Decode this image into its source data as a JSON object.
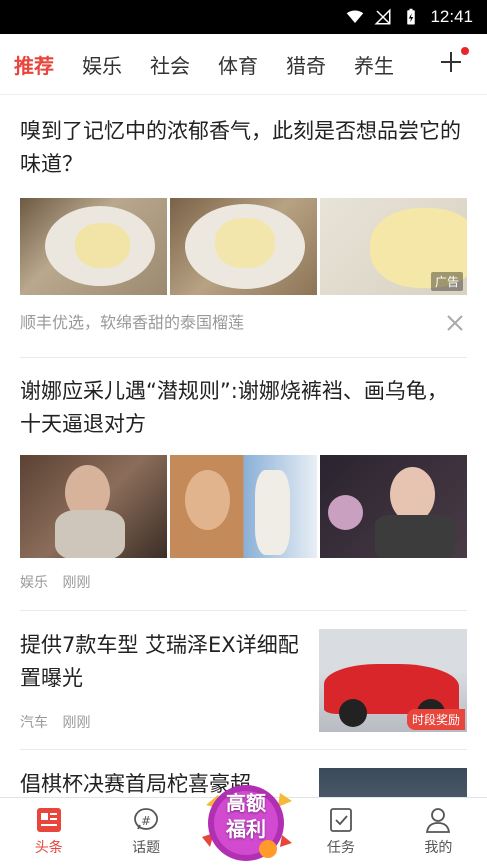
{
  "status": {
    "time": "12:41"
  },
  "tabs": [
    "推荐",
    "娱乐",
    "社会",
    "体育",
    "猎奇",
    "养生"
  ],
  "feed": {
    "ad": {
      "title": "嗅到了记忆中的浓郁香气，此刻是否想品尝它的味道？",
      "tag": "广告",
      "desc": "顺丰优选，软绵香甜的泰国榴莲"
    },
    "article1": {
      "title": "谢娜应采儿遇“潜规则”:谢娜烧裤裆、画乌龟，十天逼退对方",
      "category": "娱乐",
      "time": "刚刚"
    },
    "article2": {
      "title": "提供7款车型 艾瑞泽EX详细配置曝光",
      "category": "汽车",
      "time": "刚刚",
      "badge": "时段奖励"
    },
    "article3": {
      "title": "倡棋杯决赛首局柁喜豪超"
    }
  },
  "bottom_nav": [
    "头条",
    "话题",
    "任务",
    "我的"
  ],
  "promo": {
    "line1": "高额",
    "line2": "福利"
  },
  "colors": {
    "accent": "#e8453c",
    "status_bg": "#000000"
  }
}
